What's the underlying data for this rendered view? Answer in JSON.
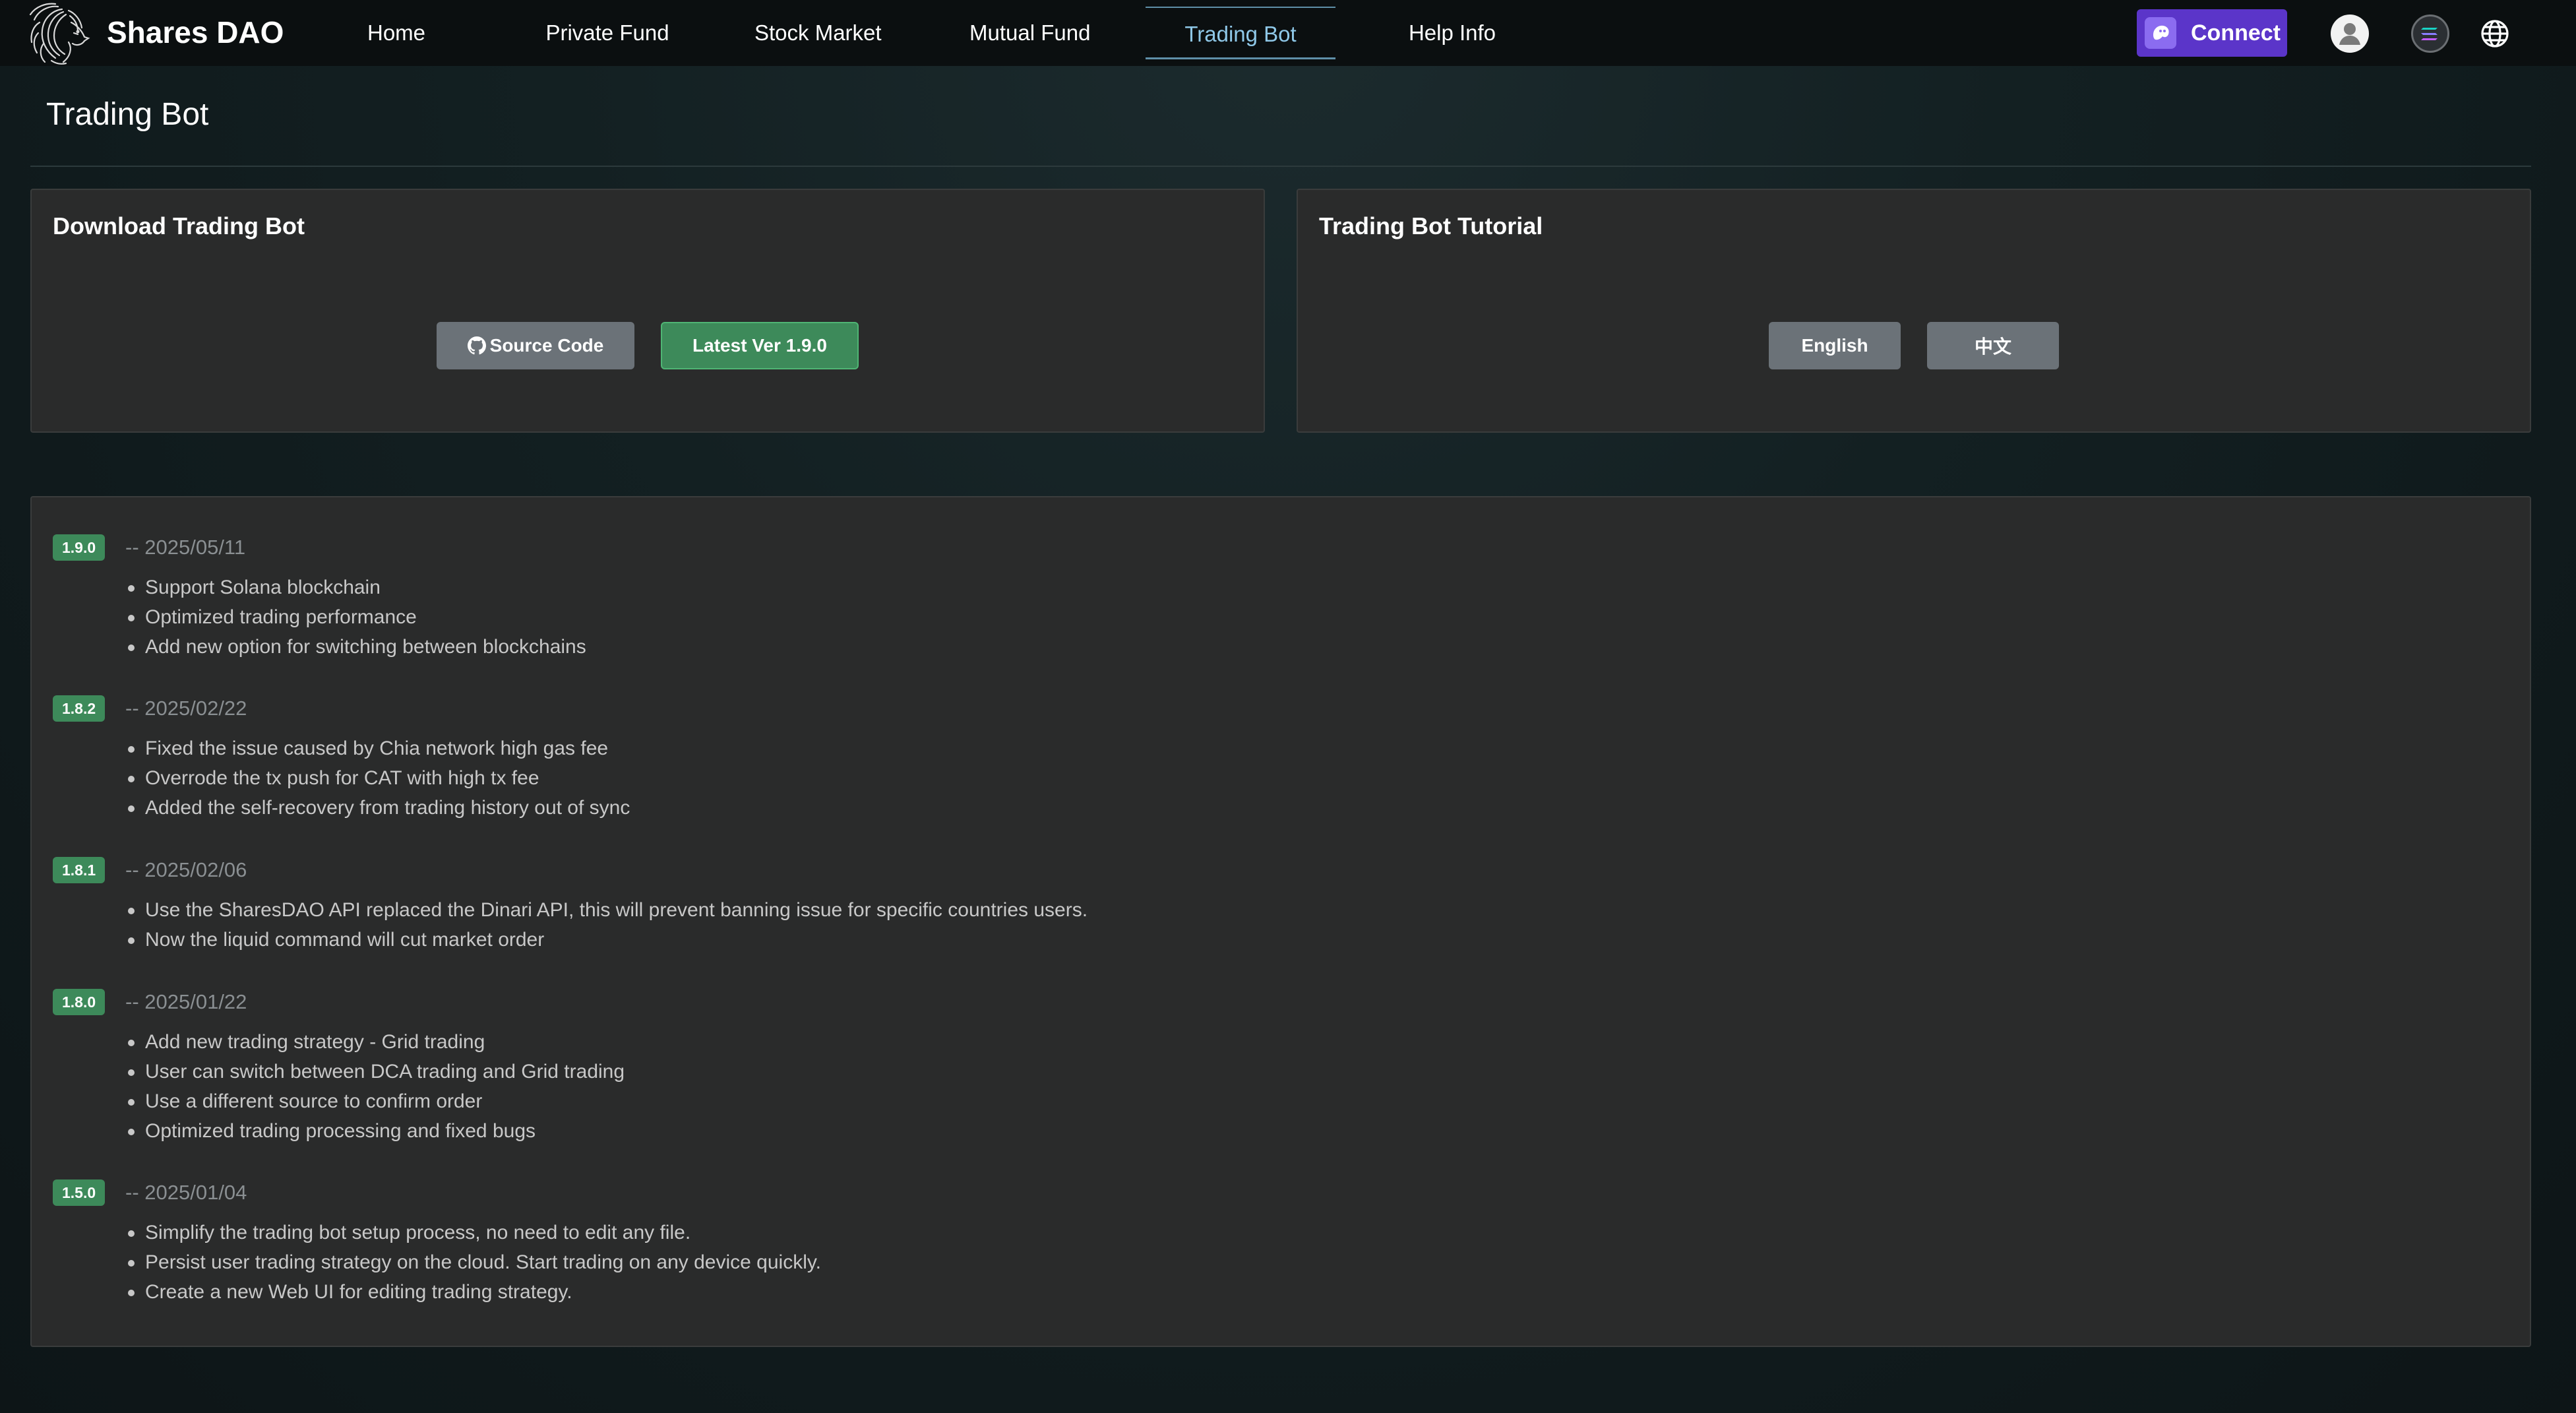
{
  "brand": {
    "name": "Shares DAO",
    "logo_icon": "lion-logo-icon"
  },
  "nav": {
    "items": [
      {
        "label": "Home"
      },
      {
        "label": "Private Fund"
      },
      {
        "label": "Stock Market"
      },
      {
        "label": "Mutual Fund"
      },
      {
        "label": "Trading Bot",
        "active": true
      },
      {
        "label": "Help Info"
      }
    ],
    "connect_label": "Connect",
    "icons": [
      "connect-wallet-icon",
      "user-avatar-icon",
      "chain-switch-icon",
      "globe-icon"
    ]
  },
  "page": {
    "title": "Trading Bot"
  },
  "download_card": {
    "title": "Download Trading Bot",
    "source_code_label": "Source Code",
    "latest_label": "Latest Ver 1.9.0",
    "source_icon": "github-icon"
  },
  "tutorial_card": {
    "title": "Trading Bot Tutorial",
    "english_label": "English",
    "chinese_label": "中文"
  },
  "changelog": [
    {
      "version": "1.9.0",
      "date": "-- 2025/05/11",
      "notes": [
        "Support Solana blockchain",
        "Optimized trading performance",
        "Add new option for switching between blockchains"
      ]
    },
    {
      "version": "1.8.2",
      "date": "-- 2025/02/22",
      "notes": [
        "Fixed the issue caused by Chia network high gas fee",
        "Overrode the tx push for CAT with high tx fee",
        "Added the self-recovery from trading history out of sync"
      ]
    },
    {
      "version": "1.8.1",
      "date": "-- 2025/02/06",
      "notes": [
        "Use the SharesDAO API replaced the Dinari API, this will prevent banning issue for specific countries users.",
        "Now the liquid command will cut market order"
      ]
    },
    {
      "version": "1.8.0",
      "date": "-- 2025/01/22",
      "notes": [
        "Add new trading strategy - Grid trading",
        "User can switch between DCA trading and Grid trading",
        "Use a different source to confirm order",
        "Optimized trading processing and fixed bugs"
      ]
    },
    {
      "version": "1.5.0",
      "date": "-- 2025/01/04",
      "notes": [
        "Simplify the trading bot setup process, no need to edit any file.",
        "Persist user trading strategy on the cloud. Start trading on any device quickly.",
        "Create a new Web UI for editing trading strategy."
      ]
    }
  ],
  "colors": {
    "accent_purple": "#5b35c9",
    "badge_green": "#3d8a5a",
    "active_nav": "#8fc8e8",
    "card_bg": "#2a2b2b"
  }
}
